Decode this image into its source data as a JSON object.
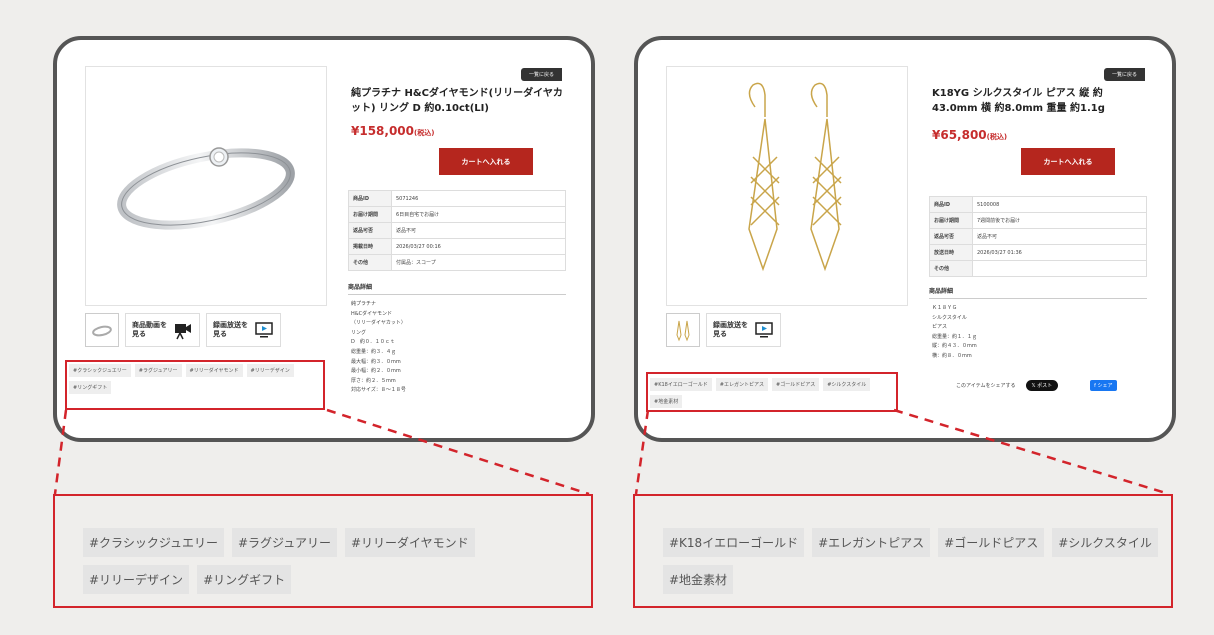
{
  "left_product": {
    "back_label": "一覧に戻る",
    "title": "純プラチナ H&Cダイヤモンド(リリーダイヤカット) リング D 約0.10ct(LI)",
    "price": "¥158,000",
    "tax_note": "(税込)",
    "cart_label": "カートへ入れる",
    "info_rows": [
      {
        "key": "商品ID",
        "value": "5071246"
      },
      {
        "key": "お届け期間",
        "value": "6日目自宅でお届け"
      },
      {
        "key": "返品可否",
        "value": "返品不可"
      },
      {
        "key": "掲載日時",
        "value": "2026/03/27 00:16"
      },
      {
        "key": "その他",
        "value": "付属品：スコープ"
      }
    ],
    "desc_title": "商品詳細",
    "desc_lines": [
      "純プラチナ",
      "H&Cダイヤモンド",
      "（リリーダイヤカット）",
      "リング",
      "D　約０．１０ｃｔ",
      "総重量：約３．４ｇ",
      "最大幅：約３．０mm",
      "最小幅：約２．０mm",
      "厚さ：約２．５mm",
      "対応サイズ：８～１８号"
    ],
    "media_buttons": [
      "商品動画を\n見る",
      "録画放送を\n見る"
    ],
    "mini_tags": [
      "#クラシックジュエリー",
      "#ラグジュアリー",
      "#リリーダイヤモンド",
      "#リリーデザイン",
      "#リングギフト"
    ],
    "zoom_tags": [
      "#クラシックジュエリー",
      "#ラグジュアリー",
      "#リリーダイヤモンド",
      "#リリーデザイン",
      "#リングギフト"
    ]
  },
  "right_product": {
    "back_label": "一覧に戻る",
    "title": "K18YG シルクスタイル ピアス 縦 約43.0mm 横 約8.0mm 重量 約1.1g",
    "price": "¥65,800",
    "tax_note": "(税込)",
    "cart_label": "カートへ入れる",
    "info_rows": [
      {
        "key": "商品ID",
        "value": "5100008"
      },
      {
        "key": "お届け期間",
        "value": "7週間前後でお届け"
      },
      {
        "key": "返品可否",
        "value": "返品不可"
      },
      {
        "key": "放送日時",
        "value": "2026/03/27 01:36"
      },
      {
        "key": "その他",
        "value": ""
      }
    ],
    "desc_title": "商品詳細",
    "desc_lines": [
      "Ｋ１８ＹＧ",
      "シルクスタイル",
      "ピアス",
      "総重量：約１．１ｇ",
      "縦：約４３．０mm",
      "横：約８．０mm"
    ],
    "media_buttons": [
      "録画放送を\n見る"
    ],
    "share_text": "このアイテムをシェアする",
    "x_post": "ポスト",
    "fb_share": "シェア",
    "mini_tags": [
      "#K18イエローゴールド",
      "#エレガントピアス",
      "#ゴールドピアス",
      "#シルクスタイル",
      "#地金素材"
    ],
    "zoom_tags": [
      "#K18イエローゴールド",
      "#エレガントピアス",
      "#ゴールドピアス",
      "#シルクスタイル",
      "#地金素材"
    ]
  },
  "colors": {
    "accent_red": "#d3242b",
    "cart_red": "#b5261e",
    "price_red": "#c62d2d",
    "panel_border": "#555555",
    "background": "#efeeec"
  },
  "icons": [
    "ring-thumb-icon",
    "video-camera-icon",
    "tv-play-icon",
    "earring-thumb-icon"
  ]
}
